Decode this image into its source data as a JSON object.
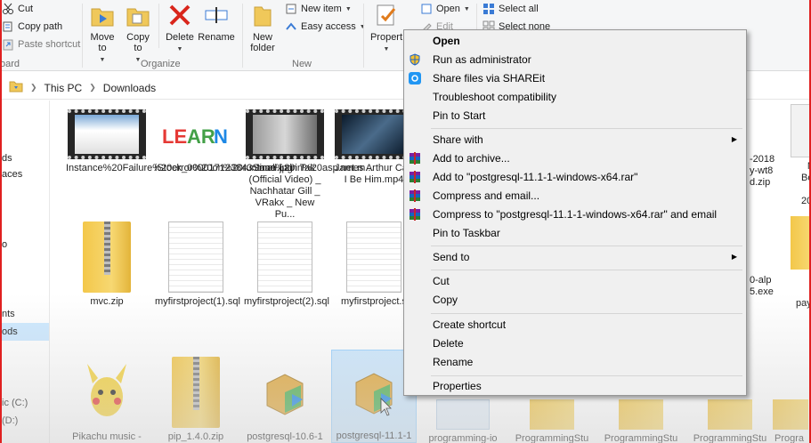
{
  "ribbon": {
    "clipboard": {
      "cut": "Cut",
      "copy_path": "Copy path",
      "paste_shortcut": "Paste shortcut",
      "group": "oard"
    },
    "organize": {
      "move_to": "Move to",
      "copy_to": "Copy to",
      "delete": "Delete",
      "rename": "Rename",
      "group": "Organize"
    },
    "new": {
      "new_folder": "New folder",
      "new_item": "New item",
      "easy_access": "Easy access",
      "group": "New"
    },
    "open": {
      "properties": "Propert",
      "open": "Open",
      "edit": "Edit"
    },
    "select": {
      "select_all": "Select all",
      "select_none": "Select none"
    }
  },
  "address": {
    "root": "This PC",
    "folder": "Downloads"
  },
  "nav": {
    "items": [
      "ds",
      "aces",
      "o",
      "nts",
      "ods",
      "ic (C:)",
      "(D:)"
    ]
  },
  "files": [
    {
      "name": "Instance%20Failure%20error%20on%20runtime%20in%20asp.net.m...",
      "kind": "video"
    },
    {
      "name": "iStock_000017123843Small.jpg",
      "kind": "image"
    },
    {
      "name": "Jaan Lain Tak (Official Video) _ Nachhatar Gill _ VRakx _ New Pu...",
      "kind": "video"
    },
    {
      "name": "James Arthur Can I Be Him.mp4",
      "kind": "video"
    },
    {
      "name": "mvc.zip",
      "kind": "zip"
    },
    {
      "name": "myfirstproject(1).sql",
      "kind": "doc"
    },
    {
      "name": "myfirstproject(2).sql",
      "kind": "doc"
    },
    {
      "name": "myfirstproject.s",
      "kind": "doc"
    },
    {
      "name": "Pikachu music -",
      "kind": "image"
    },
    {
      "name": "pip_1.4.0.zip",
      "kind": "zip"
    },
    {
      "name": "postgresql-10.6-1",
      "kind": "installer"
    },
    {
      "name": "postgresql-11.1-1",
      "kind": "installer"
    },
    {
      "name": "programming-io",
      "kind": "image"
    },
    {
      "name": "ProgrammingStu",
      "kind": "zip"
    },
    {
      "name": "ProgrammingStu",
      "kind": "zip"
    },
    {
      "name": "ProgrammingStu",
      "kind": "zip"
    },
    {
      "name": "Progra",
      "kind": "zip"
    }
  ],
  "right_cut": {
    "r1a": "-2018",
    "r1b": "y-wt8",
    "r1c": "d.zip",
    "r2a": "M",
    "r2b": "Bolly",
    "r2c": "S",
    "r2d": "2016.r",
    "r3a": "0-alp",
    "r3b": "5.exe",
    "r4a": "pay"
  },
  "context_menu": {
    "items": [
      {
        "label": "Open",
        "bold": true
      },
      {
        "label": "Run as administrator",
        "icon": "shield-icon"
      },
      {
        "label": "Share files via SHAREit",
        "icon": "shareit-icon"
      },
      {
        "label": "Troubleshoot compatibility"
      },
      {
        "label": "Pin to Start"
      },
      {
        "label": "Share with",
        "submenu": true
      },
      {
        "label": "Add to archive...",
        "icon": "winrar-icon"
      },
      {
        "label": "Add to \"postgresql-11.1-1-windows-x64.rar\"",
        "icon": "winrar-icon"
      },
      {
        "label": "Compress and email...",
        "icon": "winrar-icon"
      },
      {
        "label": "Compress to \"postgresql-11.1-1-windows-x64.rar\" and email",
        "icon": "winrar-icon"
      },
      {
        "label": "Pin to Taskbar"
      },
      {
        "label": "Send to",
        "submenu": true
      },
      {
        "label": "Cut"
      },
      {
        "label": "Copy"
      },
      {
        "label": "Create shortcut"
      },
      {
        "label": "Delete"
      },
      {
        "label": "Rename"
      },
      {
        "label": "Properties"
      }
    ],
    "arrow": "▶"
  },
  "colors": {
    "selection": "#cce8ff",
    "accent": "#0078d7",
    "menu_bg": "#f0f0f0"
  }
}
